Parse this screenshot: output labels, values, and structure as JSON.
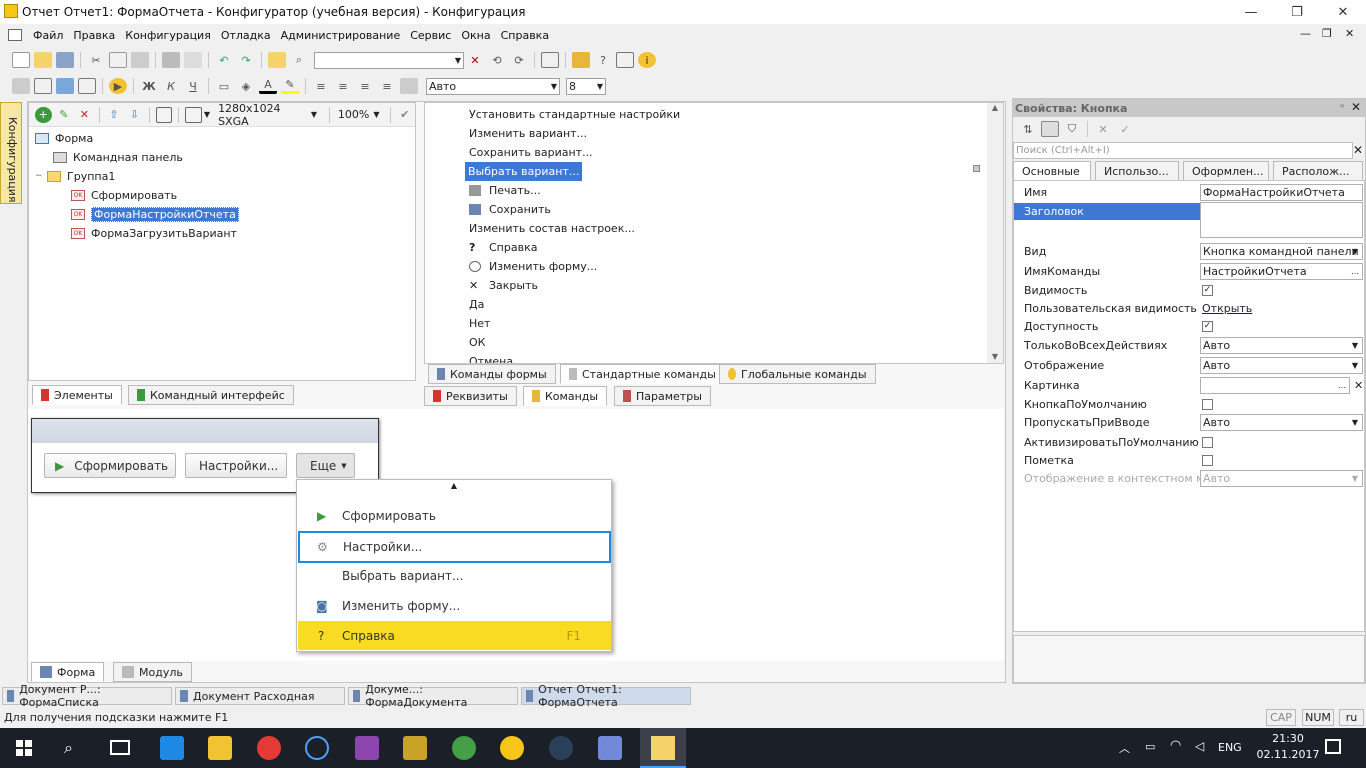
{
  "window": {
    "title": "Отчет Отчет1: ФормаОтчета - Конфигуратор (учебная версия) - Конфигурация",
    "min": "—",
    "restore": "❐",
    "close": "✕"
  },
  "menu": [
    "Файл",
    "Правка",
    "Конфигурация",
    "Отладка",
    "Администрирование",
    "Сервис",
    "Окна",
    "Справка"
  ],
  "mdi_controls": {
    "min": "—",
    "restore": "❐",
    "close": "✕"
  },
  "toolbar2": {
    "font_combo": "Авто",
    "size_combo": "8"
  },
  "side_tab": "Конфигурация",
  "form_toolbar": {
    "resolution": "1280x1024 SXGA",
    "zoom": "100%"
  },
  "tree": {
    "root": "Форма",
    "items": [
      "Командная панель",
      "Группа1",
      "Сформировать",
      "ФормаНастройкиОтчета",
      "ФормаЗагрузитьВариант"
    ]
  },
  "left_tabs": [
    "Элементы",
    "Командный интерфейс"
  ],
  "commands_list": [
    "Установить стандартные настройки",
    "Изменить вариант...",
    "Сохранить вариант...",
    "Выбрать вариант...",
    "Печать...",
    "Сохранить",
    "Изменить состав настроек...",
    "Справка",
    "Изменить форму...",
    "Закрыть",
    "Да",
    "Нет",
    "ОК",
    "Отмена"
  ],
  "cmd_tabs": [
    "Команды формы",
    "Стандартные команды",
    "Глобальные команды"
  ],
  "mid_tabs": [
    "Реквизиты",
    "Команды",
    "Параметры"
  ],
  "preview": {
    "buttons": [
      "Сформировать",
      "Настройки...",
      "Еще"
    ],
    "popup": [
      {
        "label": "Сформировать",
        "shortcut": ""
      },
      {
        "label": "Настройки...",
        "shortcut": ""
      },
      {
        "label": "Выбрать вариант...",
        "shortcut": ""
      },
      {
        "label": "Изменить форму...",
        "shortcut": ""
      },
      {
        "label": "Справка",
        "shortcut": "F1"
      }
    ]
  },
  "bottom_tabs": [
    "Форма",
    "Модуль"
  ],
  "properties": {
    "title": "Свойства: Кнопка",
    "search_placeholder": "Поиск (Ctrl+Alt+I)",
    "tabs": [
      "Основные",
      "Использо...",
      "Оформлен...",
      "Располож..."
    ],
    "rows": [
      {
        "label": "Имя",
        "value": "ФормаНастройкиОтчета"
      },
      {
        "label": "Заголовок",
        "value": ""
      },
      {
        "label": "Вид",
        "value": "Кнопка командной панели"
      },
      {
        "label": "ИмяКоманды",
        "value": "НастройкиОтчета"
      },
      {
        "label": "Видимость",
        "value": "✓"
      },
      {
        "label": "Пользовательская видимость",
        "value": "Открыть"
      },
      {
        "label": "Доступность",
        "value": "✓"
      },
      {
        "label": "ТолькоВоВсехДействиях",
        "value": "Авто"
      },
      {
        "label": "Отображение",
        "value": "Авто"
      },
      {
        "label": "Картинка",
        "value": ""
      },
      {
        "label": "КнопкаПоУмолчанию",
        "value": ""
      },
      {
        "label": "ПропускатьПриВводе",
        "value": "Авто"
      },
      {
        "label": "АктивизироватьПоУмолчанию",
        "value": ""
      },
      {
        "label": "Пометка",
        "value": ""
      },
      {
        "label": "Отображение в контекстном меню",
        "value": "Авто"
      }
    ]
  },
  "windows_bar": [
    "Документ Р...: ФормаСписка",
    "Документ Расходная",
    "Докуме...: ФормаДокумента",
    "Отчет Отчет1: ФормаОтчета"
  ],
  "status": {
    "hint": "Для получения подсказки нажмите F1",
    "cap": "CAP",
    "num": "NUM",
    "lang": "ru"
  },
  "taskbar": {
    "lang": "ENG",
    "time": "21:30",
    "date": "02.11.2017"
  },
  "colors": {
    "selection": "#3d78d6",
    "highlight": "#f9dc22",
    "accent": "#1e88e5"
  }
}
